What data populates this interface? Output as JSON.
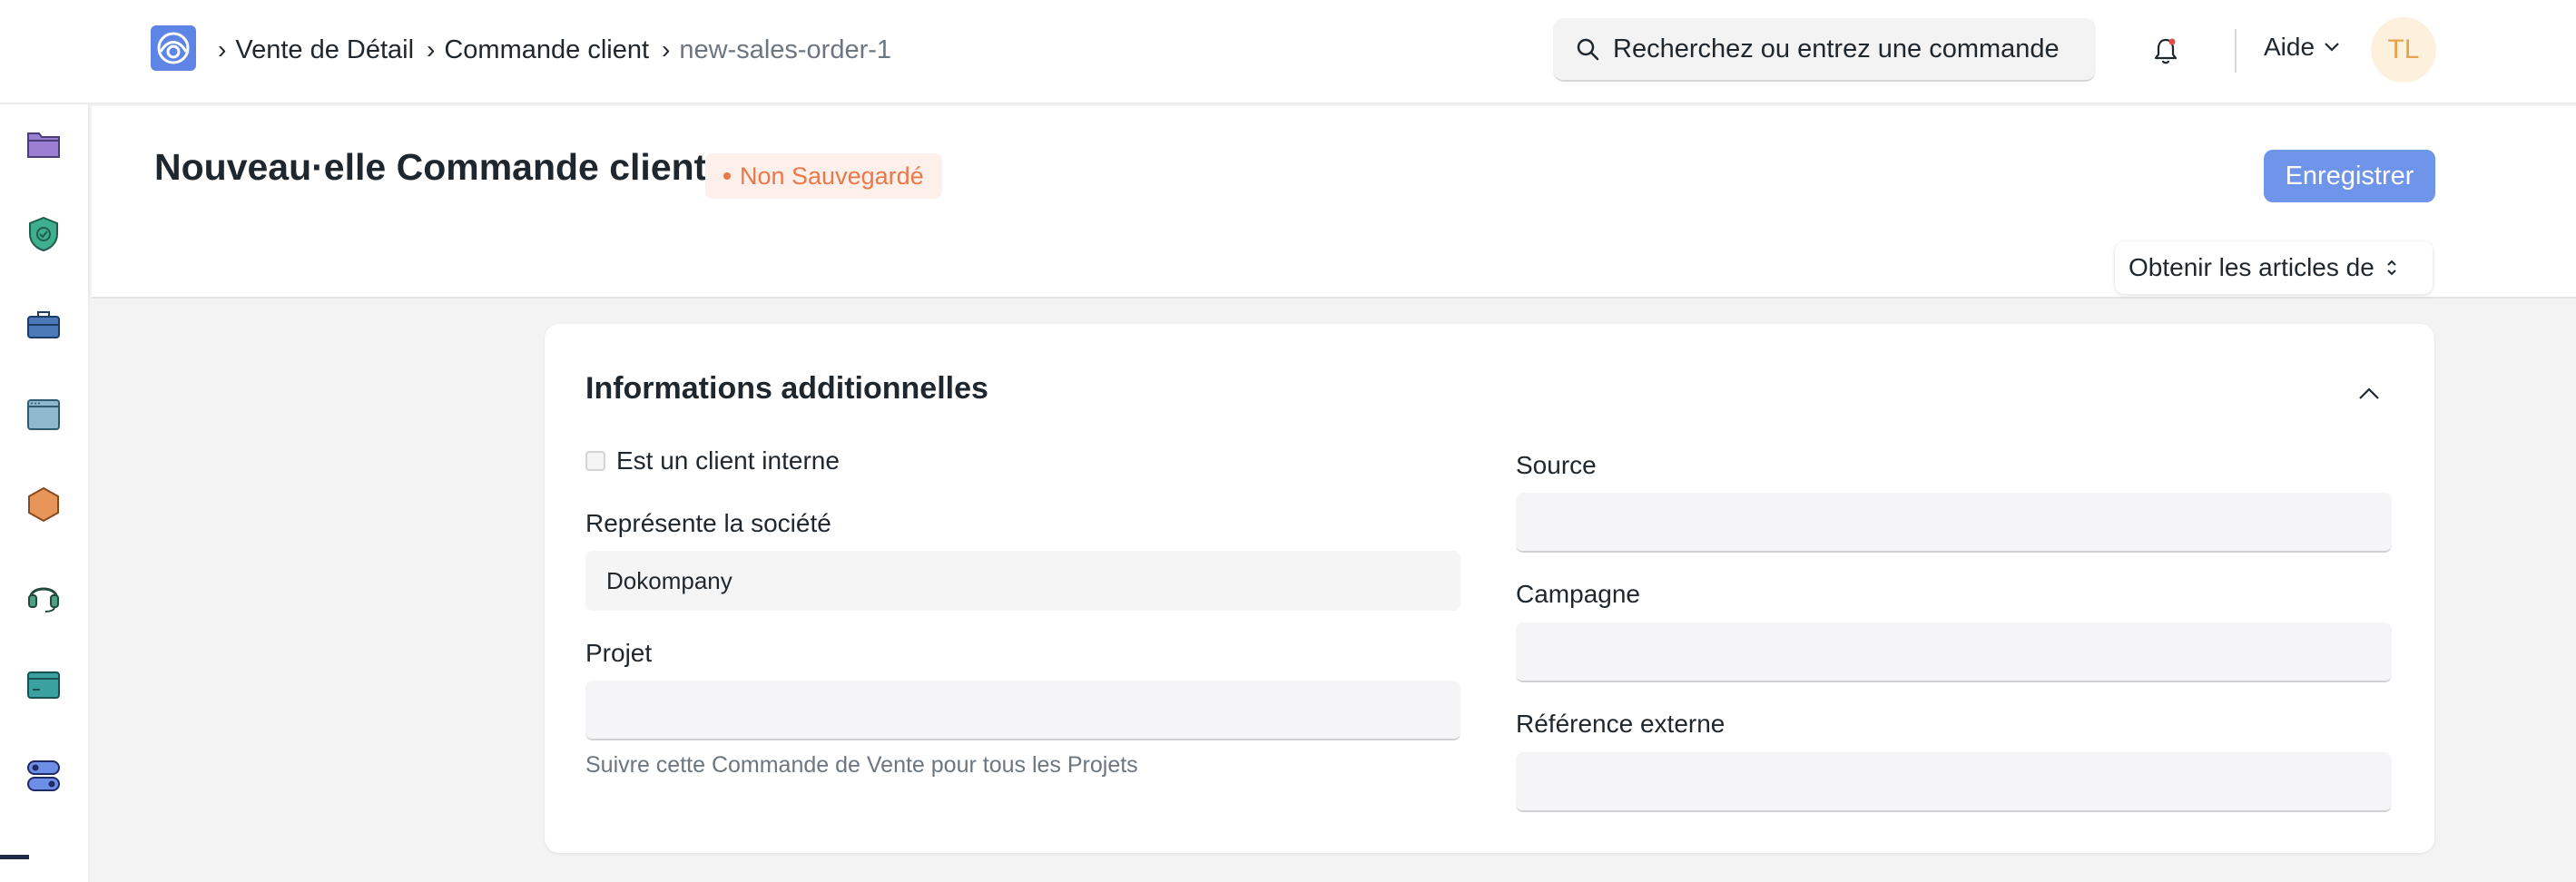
{
  "navbar": {
    "breadcrumbs": [
      "Vente de Détail",
      "Commande client",
      "new-sales-order-1"
    ],
    "search_placeholder": "Recherchez ou entrez une commande",
    "help_label": "Aide",
    "avatar_initials": "TL"
  },
  "sidebar": {
    "items": [
      "folder-icon",
      "shield-check-icon",
      "briefcase-icon",
      "window-icon",
      "hexagon-icon",
      "headset-icon",
      "card-icon",
      "toggle-icon"
    ]
  },
  "page": {
    "title": "Nouveau·elle Commande client",
    "status": "Non Sauvegardé",
    "save_label": "Enregistrer",
    "get_items_label": "Obtenir les articles de"
  },
  "section": {
    "title": "Informations additionnelles",
    "internal_customer_label": "Est un client interne",
    "internal_customer_checked": false,
    "represents_company_label": "Représente la société",
    "represents_company_value": "Dokompany",
    "project_label": "Projet",
    "project_value": "",
    "project_help": "Suivre cette Commande de Vente pour tous les Projets",
    "source_label": "Source",
    "source_value": "",
    "campaign_label": "Campagne",
    "campaign_value": "",
    "external_ref_label": "Référence externe",
    "external_ref_value": ""
  },
  "colors": {
    "primary": "#6e95ea",
    "status": "#e9784a",
    "avatar_bg": "#fdf1de",
    "avatar_fg": "#e6a34b"
  }
}
